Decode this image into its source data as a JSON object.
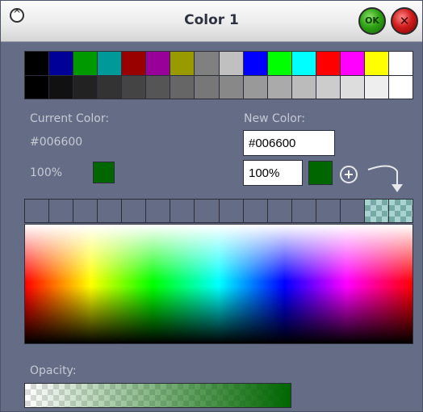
{
  "window": {
    "title": "Color 1",
    "ok_label": "OK",
    "close_label": "✕",
    "collapse_glyph": "^"
  },
  "palette": {
    "top_row": [
      "#000000",
      "#000099",
      "#009900",
      "#009999",
      "#990000",
      "#990099",
      "#999900",
      "#808080",
      "#c0c0c0",
      "#0000ff",
      "#00ff00",
      "#00ffff",
      "#ff0000",
      "#ff00ff",
      "#ffff00",
      "#ffffff"
    ],
    "bottom_row": [
      "#000000",
      "#111111",
      "#222222",
      "#333333",
      "#444444",
      "#555555",
      "#666666",
      "#777777",
      "#888888",
      "#999999",
      "#aaaaaa",
      "#bbbbbb",
      "#cccccc",
      "#dddddd",
      "#eeeeee",
      "#ffffff"
    ]
  },
  "current": {
    "label": "Current Color:",
    "hex": "#006600",
    "opacity": "100%",
    "swatch_color": "#006600"
  },
  "new": {
    "label": "New Color:",
    "hex": "#006600",
    "opacity": "100%",
    "swatch_color": "#006600",
    "add_glyph": "+"
  },
  "custom_colors": {
    "count": 16,
    "filled_slots": [
      14,
      15
    ]
  },
  "opacity": {
    "label": "Opacity:",
    "value": 1.0
  },
  "icons": {
    "collapse": "chevron-up-icon",
    "add": "plus-circle-icon",
    "arrow": "curved-arrow-down-icon"
  }
}
